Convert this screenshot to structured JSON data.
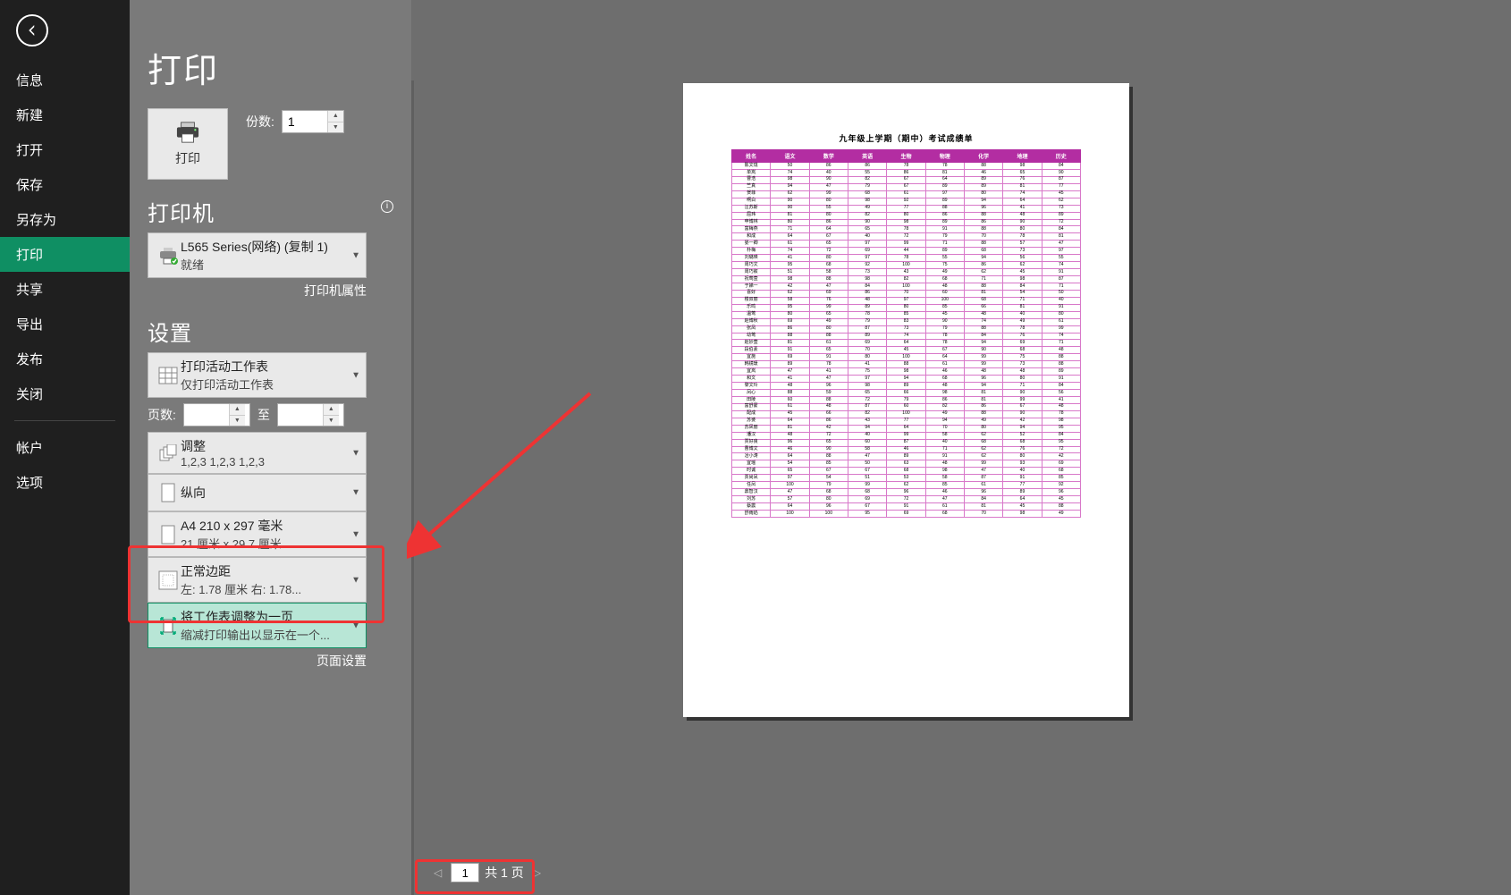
{
  "sidebar": {
    "items": [
      {
        "label": "信息"
      },
      {
        "label": "新建"
      },
      {
        "label": "打开"
      },
      {
        "label": "保存"
      },
      {
        "label": "另存为"
      },
      {
        "label": "打印"
      },
      {
        "label": "共享"
      },
      {
        "label": "导出"
      },
      {
        "label": "发布"
      },
      {
        "label": "关闭"
      },
      {
        "label": "帐户"
      },
      {
        "label": "选项"
      }
    ],
    "active_index": 5
  },
  "page_title": "打印",
  "print_button": "打印",
  "copies": {
    "label": "份数:",
    "value": "1"
  },
  "printer": {
    "section_title": "打印机",
    "name": "L565 Series(网络) (复制 1)",
    "status": "就绪",
    "properties_link": "打印机属性"
  },
  "settings": {
    "section_title": "设置",
    "what": {
      "line1": "打印活动工作表",
      "line2": "仅打印活动工作表"
    },
    "pages": {
      "label": "页数:",
      "from": "",
      "to_label": "至",
      "to": ""
    },
    "collate": {
      "line1": "调整",
      "line2": "1,2,3    1,2,3    1,2,3"
    },
    "orientation": {
      "line1": "纵向"
    },
    "paper": {
      "line1": "A4 210 x 297 毫米",
      "line2": "21 厘米 x 29.7 厘米"
    },
    "margins": {
      "line1": "正常边距",
      "line2": "左: 1.78 厘米   右: 1.78..."
    },
    "scaling": {
      "line1": "将工作表调整为一页",
      "line2": "缩减打印输出以显示在一个..."
    },
    "page_setup_link": "页面设置"
  },
  "preview": {
    "current_page": "1",
    "total_text": "共 1 页",
    "sheet_title": "九年级上学期（期中）考试成绩单",
    "columns": [
      "姓名",
      "语文",
      "数学",
      "英语",
      "生物",
      "物理",
      "化学",
      "地理",
      "历史"
    ],
    "rows": [
      [
        "陈文珑",
        "50",
        "86",
        "86",
        "78",
        "78",
        "88",
        "98",
        "84"
      ],
      [
        "单岚",
        "74",
        "40",
        "55",
        "86",
        "81",
        "46",
        "65",
        "90"
      ],
      [
        "曹浩",
        "98",
        "90",
        "82",
        "67",
        "64",
        "89",
        "76",
        "87"
      ],
      [
        "竺真",
        "94",
        "47",
        "79",
        "67",
        "89",
        "89",
        "81",
        "77"
      ],
      [
        "贺菲",
        "62",
        "99",
        "68",
        "61",
        "97",
        "80",
        "74",
        "45"
      ],
      [
        "啊白",
        "90",
        "80",
        "98",
        "92",
        "89",
        "94",
        "64",
        "62"
      ],
      [
        "汪苏斯",
        "90",
        "55",
        "49",
        "77",
        "88",
        "96",
        "41",
        "73"
      ],
      [
        "屈玮",
        "81",
        "80",
        "82",
        "80",
        "86",
        "88",
        "48",
        "89"
      ],
      [
        "申博林",
        "80",
        "86",
        "90",
        "98",
        "89",
        "86",
        "90",
        "72"
      ],
      [
        "富梅燕",
        "71",
        "64",
        "65",
        "78",
        "91",
        "88",
        "80",
        "84"
      ],
      [
        "和成",
        "64",
        "67",
        "40",
        "72",
        "79",
        "70",
        "78",
        "81"
      ],
      [
        "晏一卿",
        "61",
        "65",
        "97",
        "99",
        "71",
        "88",
        "57",
        "47"
      ],
      [
        "朴梅",
        "74",
        "72",
        "69",
        "44",
        "89",
        "68",
        "73",
        "97"
      ],
      [
        "刘璐瑛",
        "41",
        "80",
        "97",
        "78",
        "55",
        "94",
        "56",
        "55"
      ],
      [
        "周巧文",
        "95",
        "68",
        "92",
        "100",
        "75",
        "86",
        "62",
        "74"
      ],
      [
        "周巧叙",
        "51",
        "58",
        "73",
        "43",
        "49",
        "62",
        "45",
        "91"
      ],
      [
        "祝莺萱",
        "98",
        "88",
        "98",
        "82",
        "68",
        "71",
        "98",
        "87"
      ],
      [
        "于娣一",
        "42",
        "47",
        "84",
        "100",
        "48",
        "88",
        "84",
        "71"
      ],
      [
        "喜好",
        "62",
        "69",
        "86",
        "70",
        "60",
        "81",
        "54",
        "50"
      ],
      [
        "楼双丽",
        "58",
        "76",
        "48",
        "97",
        "100",
        "68",
        "71",
        "40"
      ],
      [
        "乐鸣",
        "95",
        "99",
        "89",
        "80",
        "85",
        "66",
        "81",
        "91"
      ],
      [
        "温莺",
        "80",
        "65",
        "78",
        "85",
        "45",
        "48",
        "40",
        "80"
      ],
      [
        "赵博秋",
        "69",
        "49",
        "79",
        "83",
        "90",
        "74",
        "49",
        "61"
      ],
      [
        "张凤",
        "86",
        "80",
        "87",
        "73",
        "79",
        "88",
        "78",
        "99"
      ],
      [
        "幼莺",
        "88",
        "88",
        "89",
        "74",
        "78",
        "84",
        "76",
        "74"
      ],
      [
        "赵妙萱",
        "81",
        "61",
        "69",
        "64",
        "78",
        "94",
        "69",
        "71"
      ],
      [
        "段伯素",
        "91",
        "65",
        "70",
        "45",
        "67",
        "90",
        "68",
        "48"
      ],
      [
        "宜施",
        "69",
        "91",
        "80",
        "100",
        "64",
        "99",
        "75",
        "88"
      ],
      [
        "韩镜瑗",
        "89",
        "78",
        "41",
        "88",
        "61",
        "99",
        "73",
        "88"
      ],
      [
        "宜岚",
        "47",
        "41",
        "75",
        "98",
        "46",
        "48",
        "48",
        "89"
      ],
      [
        "和文",
        "41",
        "47",
        "97",
        "94",
        "68",
        "96",
        "80",
        "91"
      ],
      [
        "黎文玲",
        "48",
        "96",
        "98",
        "89",
        "48",
        "94",
        "71",
        "84"
      ],
      [
        "凤心",
        "88",
        "59",
        "65",
        "66",
        "98",
        "81",
        "90",
        "56"
      ],
      [
        "田陵",
        "60",
        "88",
        "72",
        "79",
        "86",
        "81",
        "99",
        "41"
      ],
      [
        "富舒蒙",
        "61",
        "48",
        "87",
        "60",
        "82",
        "86",
        "67",
        "48"
      ],
      [
        "配成",
        "45",
        "66",
        "82",
        "100",
        "49",
        "88",
        "90",
        "78"
      ],
      [
        "苏婆",
        "64",
        "86",
        "43",
        "77",
        "94",
        "49",
        "42",
        "98"
      ],
      [
        "苏凤丽",
        "81",
        "42",
        "94",
        "64",
        "70",
        "80",
        "94",
        "95"
      ],
      [
        "潘汉",
        "48",
        "72",
        "40",
        "99",
        "58",
        "62",
        "52",
        "84"
      ],
      [
        "贾好良",
        "96",
        "65",
        "60",
        "87",
        "40",
        "68",
        "68",
        "95"
      ],
      [
        "曹博文",
        "46",
        "90",
        "58",
        "46",
        "71",
        "62",
        "76",
        "72"
      ],
      [
        "冶小涛",
        "64",
        "88",
        "47",
        "89",
        "91",
        "62",
        "80",
        "42"
      ],
      [
        "宜瑶",
        "54",
        "85",
        "50",
        "63",
        "48",
        "99",
        "93",
        "69"
      ],
      [
        "时诚",
        "65",
        "67",
        "67",
        "68",
        "98",
        "47",
        "40",
        "68"
      ],
      [
        "贾尚凤",
        "97",
        "54",
        "51",
        "53",
        "58",
        "87",
        "91",
        "85"
      ],
      [
        "任凤",
        "100",
        "79",
        "99",
        "62",
        "85",
        "61",
        "77",
        "92"
      ],
      [
        "鼎智汉",
        "47",
        "68",
        "68",
        "96",
        "46",
        "96",
        "89",
        "96"
      ],
      [
        "刘苏",
        "57",
        "80",
        "69",
        "72",
        "47",
        "84",
        "64",
        "45"
      ],
      [
        "蔡震",
        "64",
        "96",
        "67",
        "91",
        "61",
        "81",
        "45",
        "88"
      ],
      [
        "舒雨焰",
        "100",
        "100",
        "95",
        "69",
        "68",
        "70",
        "98",
        "49"
      ]
    ]
  }
}
